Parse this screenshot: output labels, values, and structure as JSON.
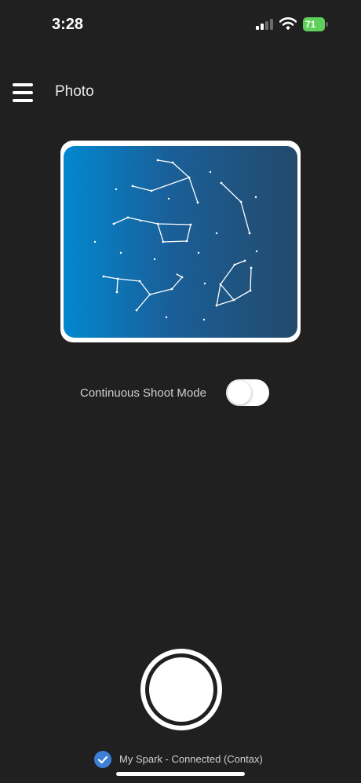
{
  "status_bar": {
    "time": "3:28",
    "battery": "71",
    "battery_color": "#5fd15a",
    "icons": [
      "cellular-signal-icon",
      "wifi-icon",
      "battery-charging-icon"
    ]
  },
  "header": {
    "menu_icon": "hamburger-menu-icon",
    "title": "Photo"
  },
  "preview": {
    "content": "constellation-star-map",
    "gradient_colors": [
      "#0288cf",
      "#234a6b"
    ]
  },
  "controls": {
    "continuous_shoot_label": "Continuous Shoot Mode",
    "continuous_shoot_enabled": false
  },
  "shutter": {
    "icon": "shutter-button"
  },
  "footer": {
    "connection_icon": "checkmark-circle-icon",
    "connection_text": "My Spark - Connected (Contax)",
    "accent_color": "#3d7fd6"
  }
}
